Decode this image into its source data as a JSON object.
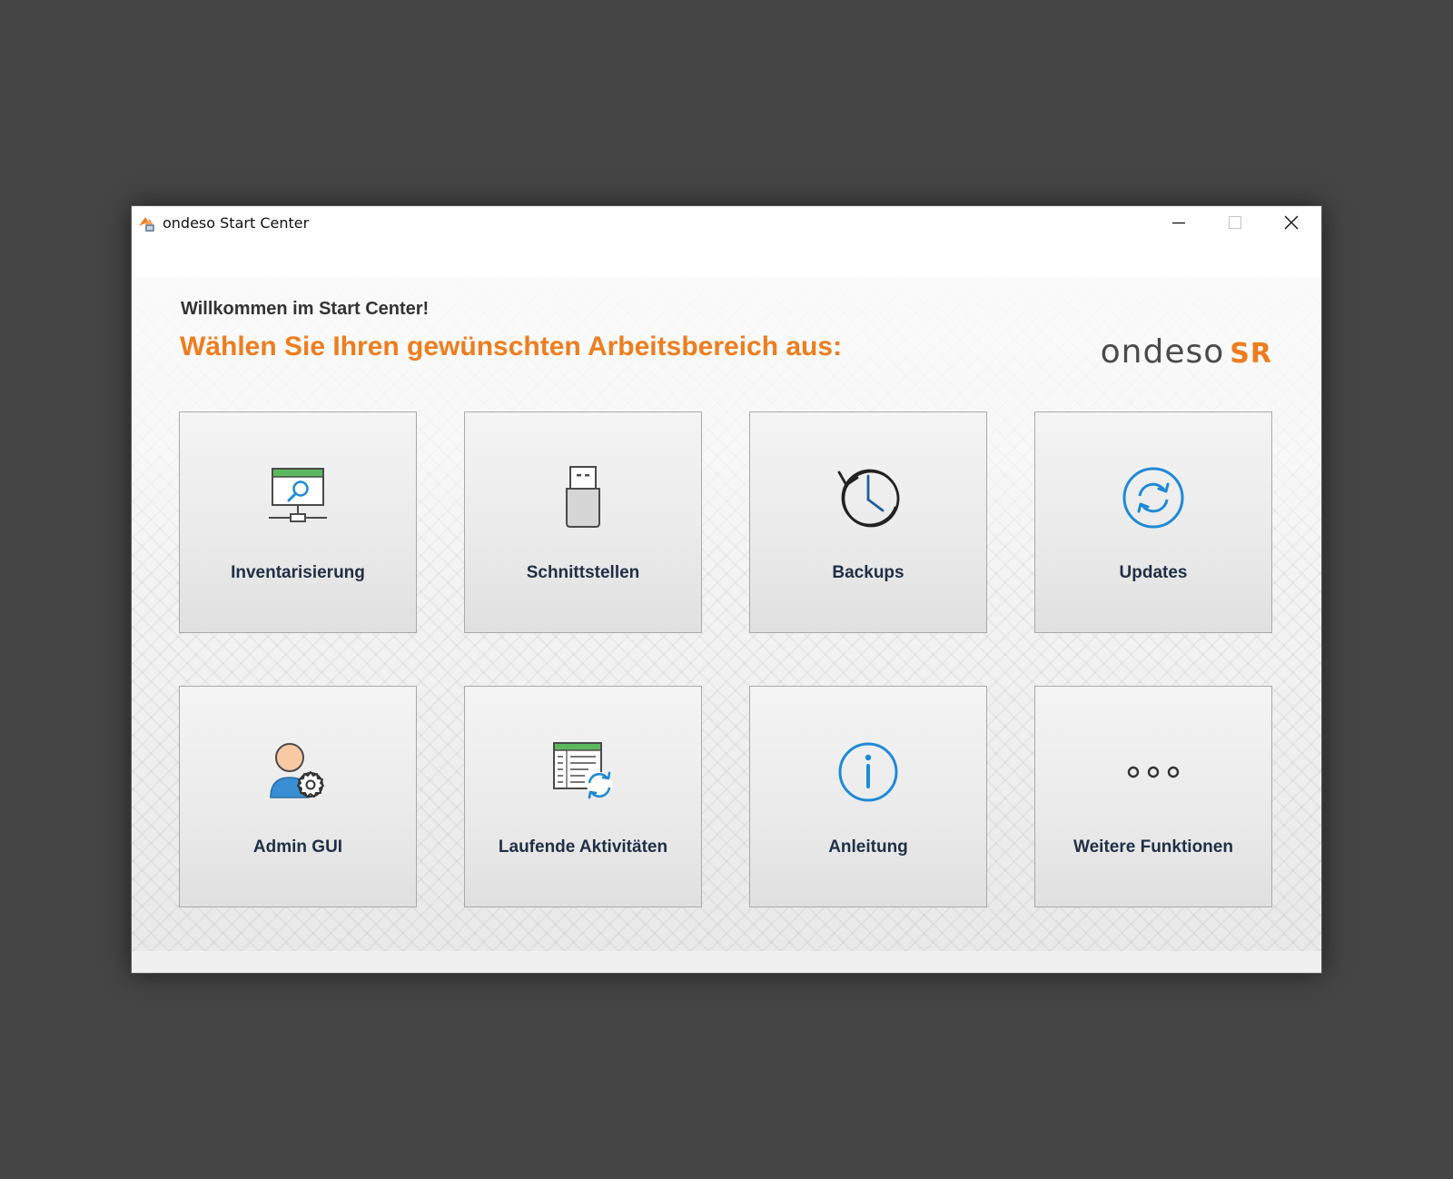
{
  "window": {
    "title": "ondeso Start Center",
    "controls": {
      "minimize": "minimize-icon",
      "maximize": "maximize-icon",
      "close": "close-icon"
    }
  },
  "header": {
    "welcome": "Willkommen im Start Center!",
    "headline": "Wählen Sie Ihren gewünschten Arbeitsbereich aus:",
    "logo_main": "ondeso",
    "logo_accent": "SR"
  },
  "colors": {
    "accent": "#ee7d1e",
    "tile_label": "#1f2f45",
    "icon_blue": "#1e8ad6",
    "icon_green": "#5cb85c",
    "icon_gray": "#4a4a4a"
  },
  "tiles": [
    {
      "label": "Inventarisierung",
      "icon": "inventory-monitor-icon"
    },
    {
      "label": "Schnittstellen",
      "icon": "usb-stick-icon"
    },
    {
      "label": "Backups",
      "icon": "history-clock-icon"
    },
    {
      "label": "Updates",
      "icon": "refresh-icon"
    },
    {
      "label": "Admin GUI",
      "icon": "admin-user-gear-icon"
    },
    {
      "label": "Laufende Aktivitäten",
      "icon": "activity-table-sync-icon"
    },
    {
      "label": "Anleitung",
      "icon": "info-icon"
    },
    {
      "label": "Weitere Funktionen",
      "icon": "more-dots-icon"
    }
  ]
}
